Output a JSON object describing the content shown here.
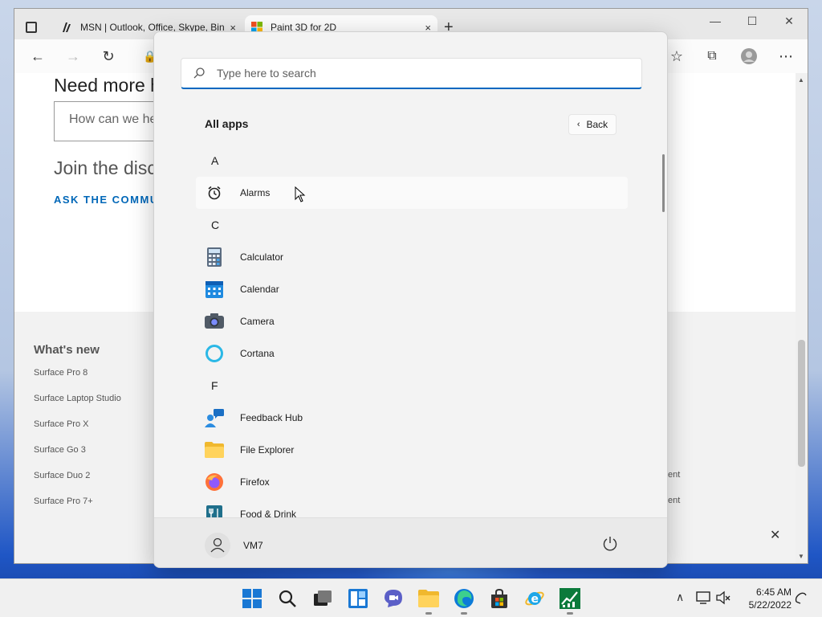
{
  "browser": {
    "tabs": [
      {
        "title": "MSN | Outlook, Office, Skype, Bing",
        "close": "×"
      },
      {
        "title": "Paint 3D for 2D",
        "close": "×"
      }
    ],
    "new_tab": "+",
    "window_controls": {
      "minimize": "—",
      "maximize": "☐",
      "close": "✕"
    },
    "page": {
      "heading": "Need more h",
      "help_placeholder": "How can we he",
      "join_text": "Join the discu",
      "ask_link": "ASK THE COMMUN",
      "whats_new_title": "What's new",
      "whats_new_items": [
        "Surface Pro 8",
        "Surface Laptop Studio",
        "Surface Pro X",
        "Surface Go 3",
        "Surface Duo 2",
        "Surface Pro 7+"
      ],
      "right_fragments": [
        "ent",
        "ent"
      ],
      "close": "✕"
    }
  },
  "start_menu": {
    "search_placeholder": "Type here to search",
    "title": "All apps",
    "back_label": "Back",
    "groups": [
      {
        "letter": "A",
        "apps": [
          {
            "name": "Alarms",
            "icon": "alarm-clock-icon"
          }
        ]
      },
      {
        "letter": "C",
        "apps": [
          {
            "name": "Calculator",
            "icon": "calculator-icon"
          },
          {
            "name": "Calendar",
            "icon": "calendar-icon"
          },
          {
            "name": "Camera",
            "icon": "camera-icon"
          },
          {
            "name": "Cortana",
            "icon": "cortana-icon"
          }
        ]
      },
      {
        "letter": "F",
        "apps": [
          {
            "name": "Feedback Hub",
            "icon": "feedback-hub-icon"
          },
          {
            "name": "File Explorer",
            "icon": "file-explorer-icon"
          },
          {
            "name": "Firefox",
            "icon": "firefox-icon"
          },
          {
            "name": "Food & Drink",
            "icon": "food-drink-icon"
          }
        ]
      }
    ],
    "user_name": "VM7"
  },
  "taskbar": {
    "icons": [
      "start-icon",
      "search-icon",
      "task-view-icon",
      "widgets-icon",
      "chat-icon",
      "file-explorer-icon",
      "edge-icon",
      "store-icon",
      "internet-explorer-icon",
      "stocks-icon"
    ],
    "time": "6:45 AM",
    "date": "5/22/2022"
  },
  "colors": {
    "accent": "#0067c0",
    "link": "#0067b8",
    "start_bg": "#f3f3f3",
    "taskbar_bg": "#f0f0f0"
  }
}
